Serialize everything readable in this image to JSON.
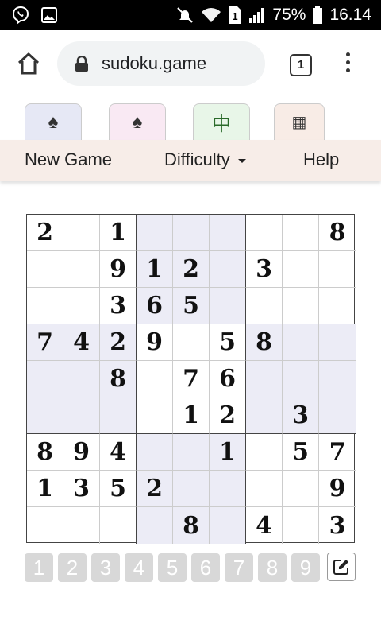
{
  "status_bar": {
    "icons": [
      "viber-icon",
      "image-icon",
      "mute-icon",
      "wifi-icon",
      "sim-1-icon",
      "signal-icon",
      "battery-icon"
    ],
    "sim_label": "1",
    "battery": "75%",
    "time": "16.14"
  },
  "browser": {
    "url": "sudoku.game",
    "tab_count": "1"
  },
  "game_tabs": [
    {
      "icon": "spade-icon",
      "glyph": "♠"
    },
    {
      "icon": "spade-icon",
      "glyph": "♠"
    },
    {
      "icon": "mahjong-tile-icon",
      "glyph": "中"
    },
    {
      "icon": "grid-icon",
      "glyph": "▦"
    }
  ],
  "menu": {
    "new_game": "New Game",
    "difficulty": "Difficulty",
    "help": "Help"
  },
  "grid": [
    [
      "2",
      "",
      "1",
      "",
      "",
      "",
      "",
      "",
      "8"
    ],
    [
      "",
      "",
      "9",
      "1",
      "2",
      "",
      "3",
      "",
      ""
    ],
    [
      "",
      "",
      "3",
      "6",
      "5",
      "",
      "",
      "",
      ""
    ],
    [
      "7",
      "4",
      "2",
      "9",
      "",
      "5",
      "8",
      "",
      ""
    ],
    [
      "",
      "",
      "8",
      "",
      "7",
      "6",
      "",
      "",
      ""
    ],
    [
      "",
      "",
      "",
      "",
      "1",
      "2",
      "",
      "3",
      ""
    ],
    [
      "8",
      "9",
      "4",
      "",
      "",
      "1",
      "",
      "5",
      "7"
    ],
    [
      "1",
      "3",
      "5",
      "2",
      "",
      "",
      "",
      "",
      "9"
    ],
    [
      "",
      "",
      "",
      "",
      "8",
      "",
      "4",
      "",
      "3"
    ]
  ],
  "numpad": [
    "1",
    "2",
    "3",
    "4",
    "5",
    "6",
    "7",
    "8",
    "9"
  ],
  "colors": {
    "shaded_box": "#ececf6",
    "menu_bg": "#f7ede8",
    "numpad_key": "#d8d8d8"
  }
}
